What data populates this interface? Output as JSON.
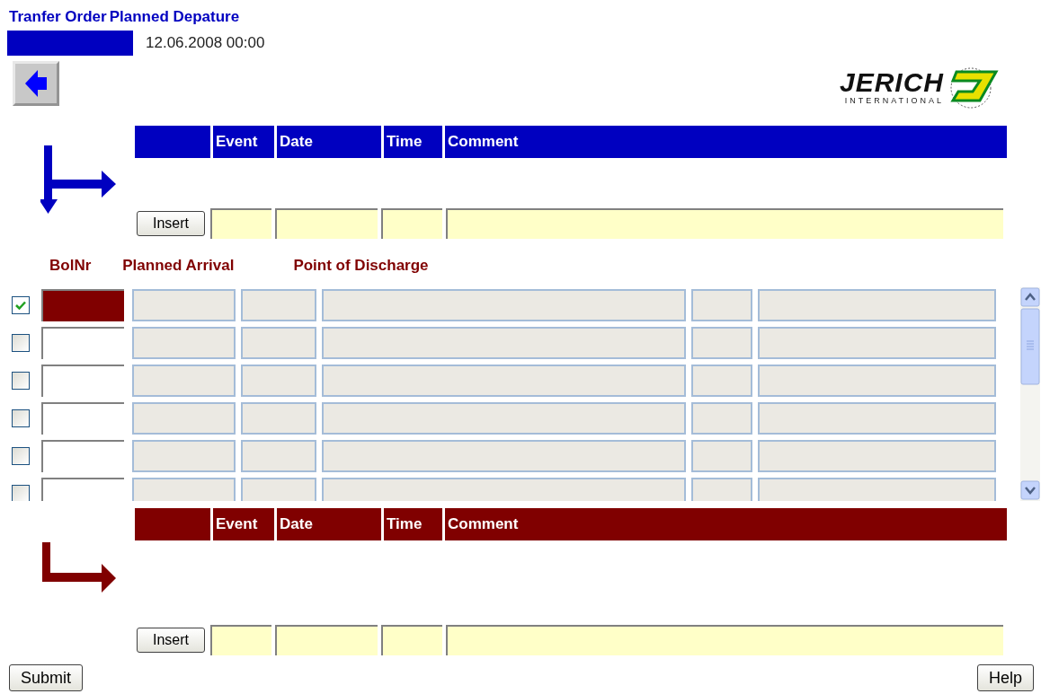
{
  "header": {
    "title": "Tranfer Order",
    "subtitle": "Planned Depature",
    "date": "12.06.2008 00:00"
  },
  "logo": {
    "name": "JERICH",
    "tagline": "INTERNATIONAL"
  },
  "top_events": {
    "columns": [
      "Event",
      "Date",
      "Time",
      "Comment"
    ],
    "insert_button": "Insert"
  },
  "grid": {
    "labels": [
      "BolNr",
      "Planned Arrival",
      "Point of Discharge"
    ],
    "rows": [
      {
        "checked": true,
        "selected": true
      },
      {
        "checked": false,
        "selected": false
      },
      {
        "checked": false,
        "selected": false
      },
      {
        "checked": false,
        "selected": false
      },
      {
        "checked": false,
        "selected": false
      },
      {
        "checked": false,
        "selected": false
      }
    ]
  },
  "bottom_events": {
    "columns": [
      "Event",
      "Date",
      "Time",
      "Comment"
    ],
    "insert_button": "Insert"
  },
  "buttons": {
    "submit": "Submit",
    "help": "Help"
  }
}
